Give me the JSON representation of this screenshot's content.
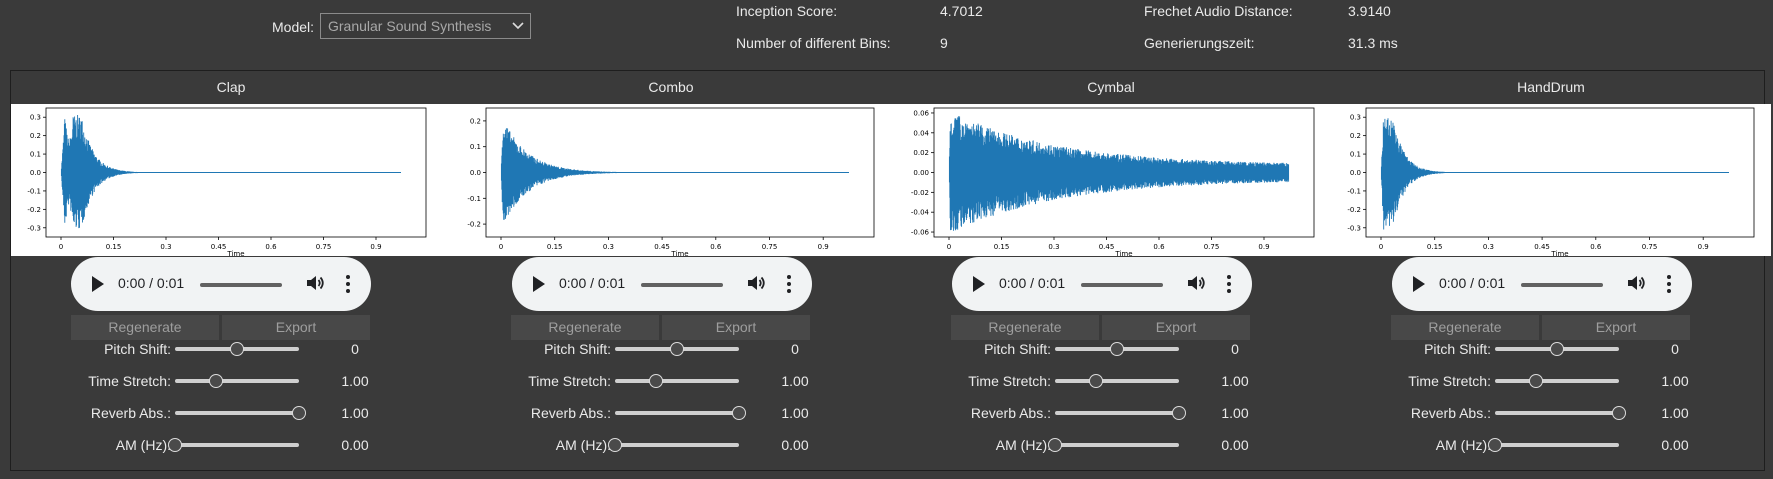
{
  "header": {
    "model_label": "Model:",
    "model_value": "Granular Sound Synthesis",
    "metrics": [
      {
        "label": "Inception Score:",
        "value": "4.7012"
      },
      {
        "label": "Number of different Bins:",
        "value": "9"
      },
      {
        "label": "Frechet Audio Distance:",
        "value": "3.9140"
      },
      {
        "label": "Generierungszeit:",
        "value": "31.3 ms"
      }
    ]
  },
  "columns": [
    {
      "title": "Clap",
      "plot": {
        "xlabel": "Time",
        "xticks": [
          "0",
          "0.15",
          "0.3",
          "0.45",
          "0.6",
          "0.75",
          "0.9"
        ],
        "yticks": [
          "0.3",
          "0.2",
          "0.1",
          "0.0",
          "-0.1",
          "-0.2",
          "-0.3"
        ],
        "ylim": [
          -0.35,
          0.35
        ]
      },
      "audio_time": "0:00 / 0:01",
      "regenerate_label": "Regenerate",
      "export_label": "Export",
      "controls": [
        {
          "label": "Pitch Shift:",
          "value": "0",
          "position": 0.5
        },
        {
          "label": "Time Stretch:",
          "value": "1.00",
          "position": 0.33
        },
        {
          "label": "Reverb Abs.:",
          "value": "1.00",
          "position": 1.0
        },
        {
          "label": "AM (Hz):",
          "value": "0.00",
          "position": 0.0
        }
      ]
    },
    {
      "title": "Combo",
      "plot": {
        "xlabel": "Time",
        "xticks": [
          "0",
          "0.15",
          "0.3",
          "0.45",
          "0.6",
          "0.75",
          "0.9"
        ],
        "yticks": [
          "0.2",
          "0.1",
          "0.0",
          "-0.1",
          "-0.2"
        ],
        "ylim": [
          -0.25,
          0.25
        ]
      },
      "audio_time": "0:00 / 0:01",
      "regenerate_label": "Regenerate",
      "export_label": "Export",
      "controls": [
        {
          "label": "Pitch Shift:",
          "value": "0",
          "position": 0.5
        },
        {
          "label": "Time Stretch:",
          "value": "1.00",
          "position": 0.33
        },
        {
          "label": "Reverb Abs.:",
          "value": "1.00",
          "position": 1.0
        },
        {
          "label": "AM (Hz):",
          "value": "0.00",
          "position": 0.0
        }
      ]
    },
    {
      "title": "Cymbal",
      "plot": {
        "xlabel": "Time",
        "xticks": [
          "0",
          "0.15",
          "0.3",
          "0.45",
          "0.6",
          "0.75",
          "0.9"
        ],
        "yticks": [
          "0.06",
          "0.04",
          "0.02",
          "0.00",
          "-0.02",
          "-0.04",
          "-0.06"
        ],
        "ylim": [
          -0.065,
          0.065
        ]
      },
      "audio_time": "0:00 / 0:01",
      "regenerate_label": "Regenerate",
      "export_label": "Export",
      "controls": [
        {
          "label": "Pitch Shift:",
          "value": "0",
          "position": 0.5
        },
        {
          "label": "Time Stretch:",
          "value": "1.00",
          "position": 0.33
        },
        {
          "label": "Reverb Abs.:",
          "value": "1.00",
          "position": 1.0
        },
        {
          "label": "AM (Hz):",
          "value": "0.00",
          "position": 0.0
        }
      ]
    },
    {
      "title": "HandDrum",
      "plot": {
        "xlabel": "Time",
        "xticks": [
          "0",
          "0.15",
          "0.3",
          "0.45",
          "0.6",
          "0.75",
          "0.9"
        ],
        "yticks": [
          "0.3",
          "0.2",
          "0.1",
          "0.0",
          "-0.1",
          "-0.2",
          "-0.3"
        ],
        "ylim": [
          -0.35,
          0.35
        ]
      },
      "audio_time": "0:00 / 0:01",
      "regenerate_label": "Regenerate",
      "export_label": "Export",
      "controls": [
        {
          "label": "Pitch Shift:",
          "value": "0",
          "position": 0.5
        },
        {
          "label": "Time Stretch:",
          "value": "1.00",
          "position": 0.33
        },
        {
          "label": "Reverb Abs.:",
          "value": "1.00",
          "position": 1.0
        },
        {
          "label": "AM (Hz):",
          "value": "0.00",
          "position": 0.0
        }
      ]
    }
  ],
  "colors": {
    "waveform": "#1f77b4",
    "background": "#3a3a3a",
    "button": "#484848"
  },
  "icons": {
    "play": "play-icon",
    "volume": "volume-icon",
    "more": "more-vert-icon",
    "dropdown": "chevron-down-icon"
  }
}
